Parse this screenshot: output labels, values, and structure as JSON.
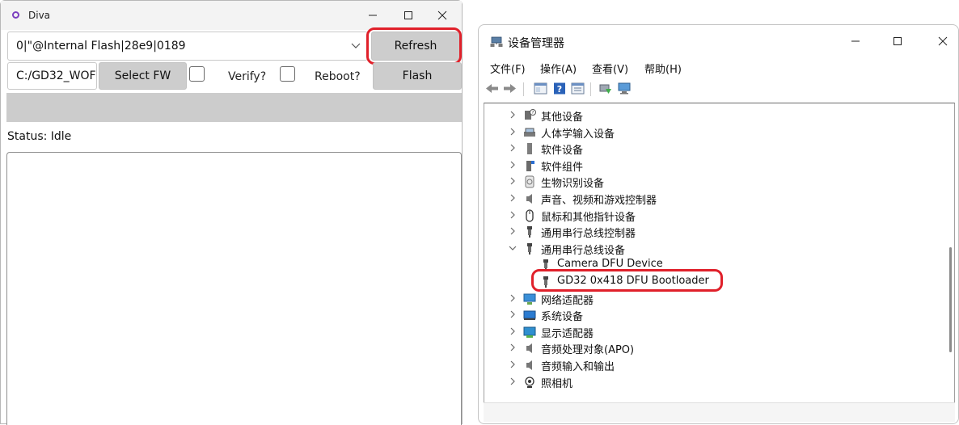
{
  "diva": {
    "title": "Diva",
    "device_select_value": "0|\"@Internal Flash|28e9|0189",
    "refresh_label": "Refresh",
    "firmware_path": "C:/GD32_WOF",
    "select_fw_label": "Select FW",
    "verify_label": "Verify?",
    "reboot_label": "Reboot?",
    "flash_label": "Flash",
    "status_text": "Status: Idle",
    "verify_checked": false,
    "reboot_checked": false,
    "highlight_color": "#e0202a"
  },
  "devmgr": {
    "title": "设备管理器",
    "menu": [
      {
        "label": "文件(F)"
      },
      {
        "label": "操作(A)"
      },
      {
        "label": "查看(V)"
      },
      {
        "label": "帮助(H)"
      }
    ],
    "toolbar_icons": [
      "back-icon",
      "forward-icon",
      "properties-icon",
      "help-icon",
      "view-icon",
      "update-driver-icon",
      "scan-hardware-icon"
    ],
    "tree": [
      {
        "label": "其他设备",
        "icon": "other-device-icon",
        "expander": ">"
      },
      {
        "label": "人体学输入设备",
        "icon": "hid-icon",
        "expander": ">"
      },
      {
        "label": "软件设备",
        "icon": "software-device-icon",
        "expander": ">"
      },
      {
        "label": "软件组件",
        "icon": "software-component-icon",
        "expander": ">"
      },
      {
        "label": "生物识别设备",
        "icon": "biometric-icon",
        "expander": ">"
      },
      {
        "label": "声音、视频和游戏控制器",
        "icon": "speaker-icon",
        "expander": ">"
      },
      {
        "label": "鼠标和其他指针设备",
        "icon": "mouse-icon",
        "expander": ">"
      },
      {
        "label": "通用串行总线控制器",
        "icon": "usb-icon",
        "expander": ">"
      },
      {
        "label": "通用串行总线设备",
        "icon": "usb-icon",
        "expander": "v"
      },
      {
        "label": "Camera DFU Device",
        "icon": "usb-icon",
        "expander": ""
      },
      {
        "label": "GD32 0x418 DFU Bootloader",
        "icon": "usb-icon",
        "expander": ""
      },
      {
        "label": "网络适配器",
        "icon": "network-icon",
        "expander": ">"
      },
      {
        "label": "系统设备",
        "icon": "system-icon",
        "expander": ">"
      },
      {
        "label": "显示适配器",
        "icon": "display-icon",
        "expander": ">"
      },
      {
        "label": "音频处理对象(APO)",
        "icon": "speaker-icon",
        "expander": ">"
      },
      {
        "label": "音频输入和输出",
        "icon": "speaker-icon",
        "expander": ">"
      },
      {
        "label": "照相机",
        "icon": "camera-icon",
        "expander": ">"
      }
    ]
  }
}
